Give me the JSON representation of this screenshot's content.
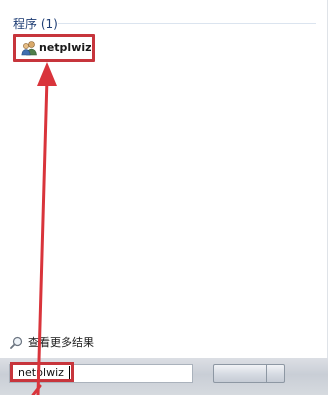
{
  "results": {
    "header": "程序 (1)",
    "items": [
      {
        "label": "netplwiz",
        "icon": "users-accounts-icon"
      }
    ]
  },
  "more_results": {
    "label": "查看更多结果",
    "icon": "magnifier-icon"
  },
  "search": {
    "value": "netplwiz"
  },
  "annotation": {
    "color": "#d9343b"
  }
}
